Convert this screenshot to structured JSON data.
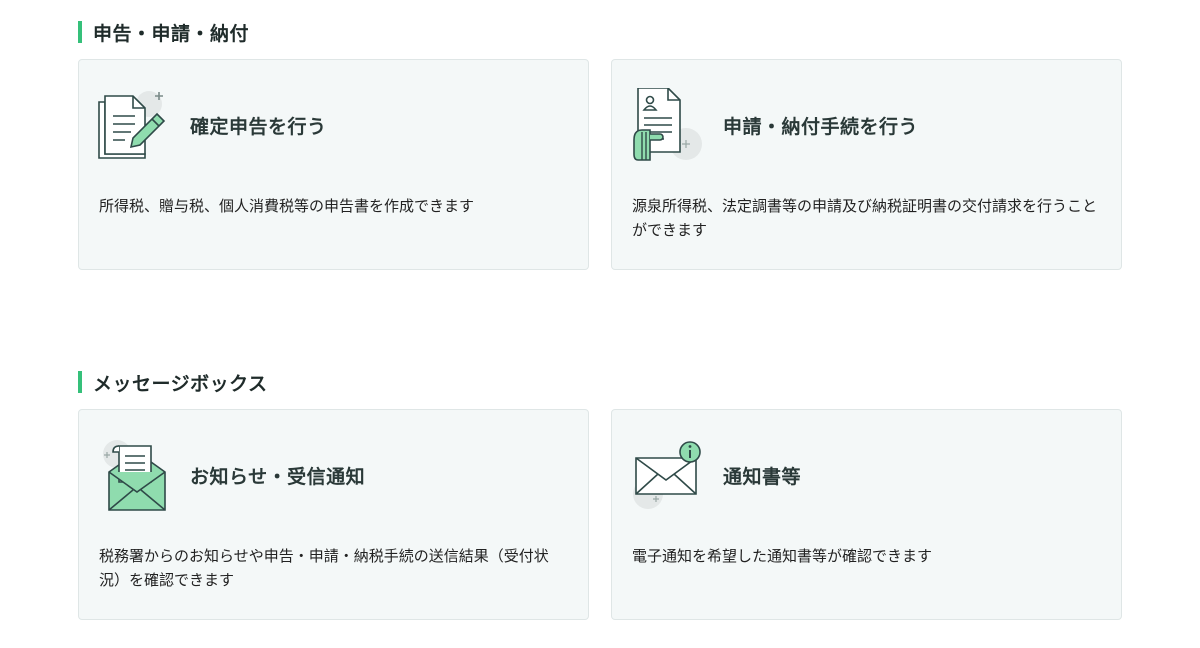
{
  "sections": [
    {
      "title": "申告・申請・納付",
      "cards": [
        {
          "title": "確定申告を行う",
          "description": "所得税、贈与税、個人消費税等の申告書を作成できます",
          "icon": "document-pencil-icon"
        },
        {
          "title": "申請・納付手続を行う",
          "description": "源泉所得税、法定調書等の申請及び納税証明書の交付請求を行うことができます",
          "icon": "hand-document-icon"
        }
      ]
    },
    {
      "title": "メッセージボックス",
      "cards": [
        {
          "title": "お知らせ・受信通知",
          "description": "税務署からのお知らせや申告・申請・納税手続の送信結果（受付状況）を確認できます",
          "icon": "open-envelope-letter-icon"
        },
        {
          "title": "通知書等",
          "description": "電子通知を希望した通知書等が確認できます",
          "icon": "envelope-info-icon"
        }
      ]
    }
  ],
  "colors": {
    "accent": "#35c07a",
    "icon_green": "#8fdcae",
    "icon_stroke": "#2f4a48",
    "card_bg": "#f4f8f8",
    "card_border": "#dfe6e6"
  }
}
